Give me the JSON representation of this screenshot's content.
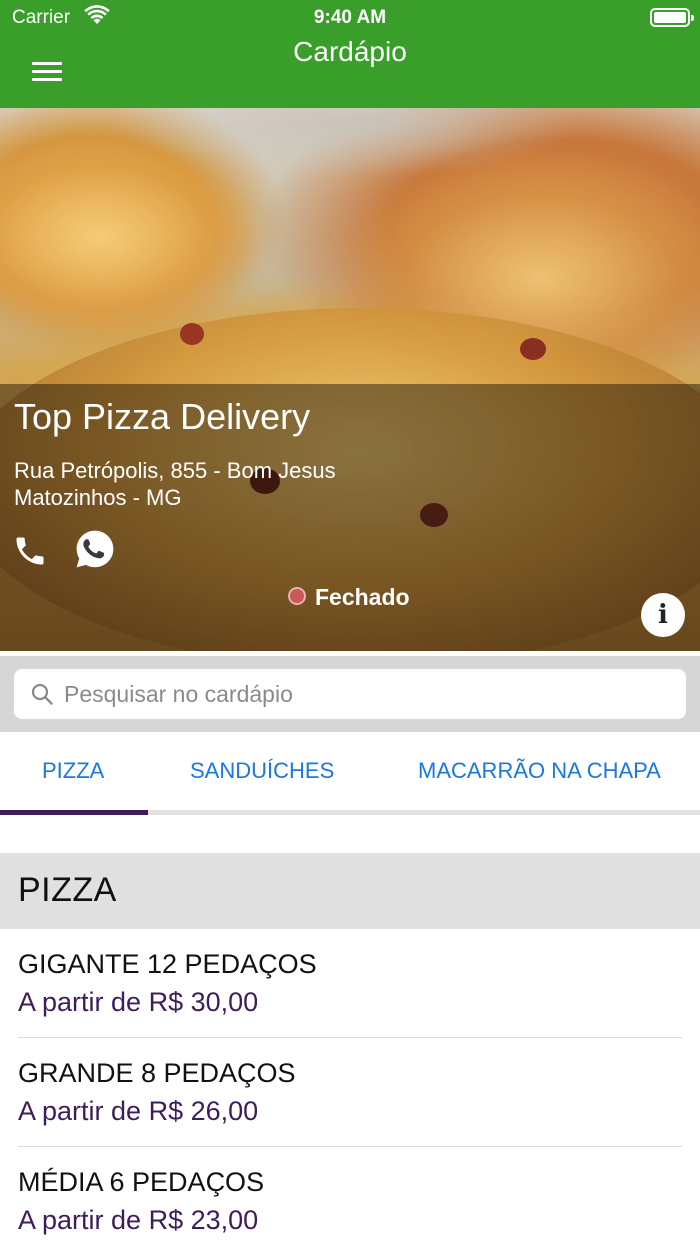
{
  "status_bar": {
    "carrier": "Carrier",
    "time": "9:40 AM"
  },
  "header": {
    "title": "Cardápio"
  },
  "restaurant": {
    "name": "Top Pizza Delivery",
    "address_line1": "Rua Petrópolis, 855 - Bom Jesus",
    "address_line2": "Matozinhos - MG",
    "status": "Fechado",
    "info_label": "i"
  },
  "search": {
    "placeholder": "Pesquisar no cardápio",
    "value": ""
  },
  "tabs": [
    {
      "label": "PIZZA",
      "active": true
    },
    {
      "label": "SANDUÍCHES",
      "active": false
    },
    {
      "label": "MACARRÃO NA CHAPA",
      "active": false
    }
  ],
  "section": {
    "title": "PIZZA"
  },
  "items": [
    {
      "name": "GIGANTE 12 PEDAÇOS",
      "price": "A partir de R$ 30,00"
    },
    {
      "name": "GRANDE 8 PEDAÇOS",
      "price": "A partir de R$ 26,00"
    },
    {
      "name": "MÉDIA 6 PEDAÇOS",
      "price": "A partir de R$ 23,00"
    }
  ],
  "colors": {
    "header_green": "#3a9e2a",
    "tab_blue": "#1a78e0",
    "price_purple": "#3d1d5a",
    "status_closed_red": "#c85a5a"
  },
  "icons": [
    "menu-icon",
    "wifi-icon",
    "battery-icon",
    "phone-icon",
    "whatsapp-icon",
    "info-icon",
    "search-icon"
  ]
}
